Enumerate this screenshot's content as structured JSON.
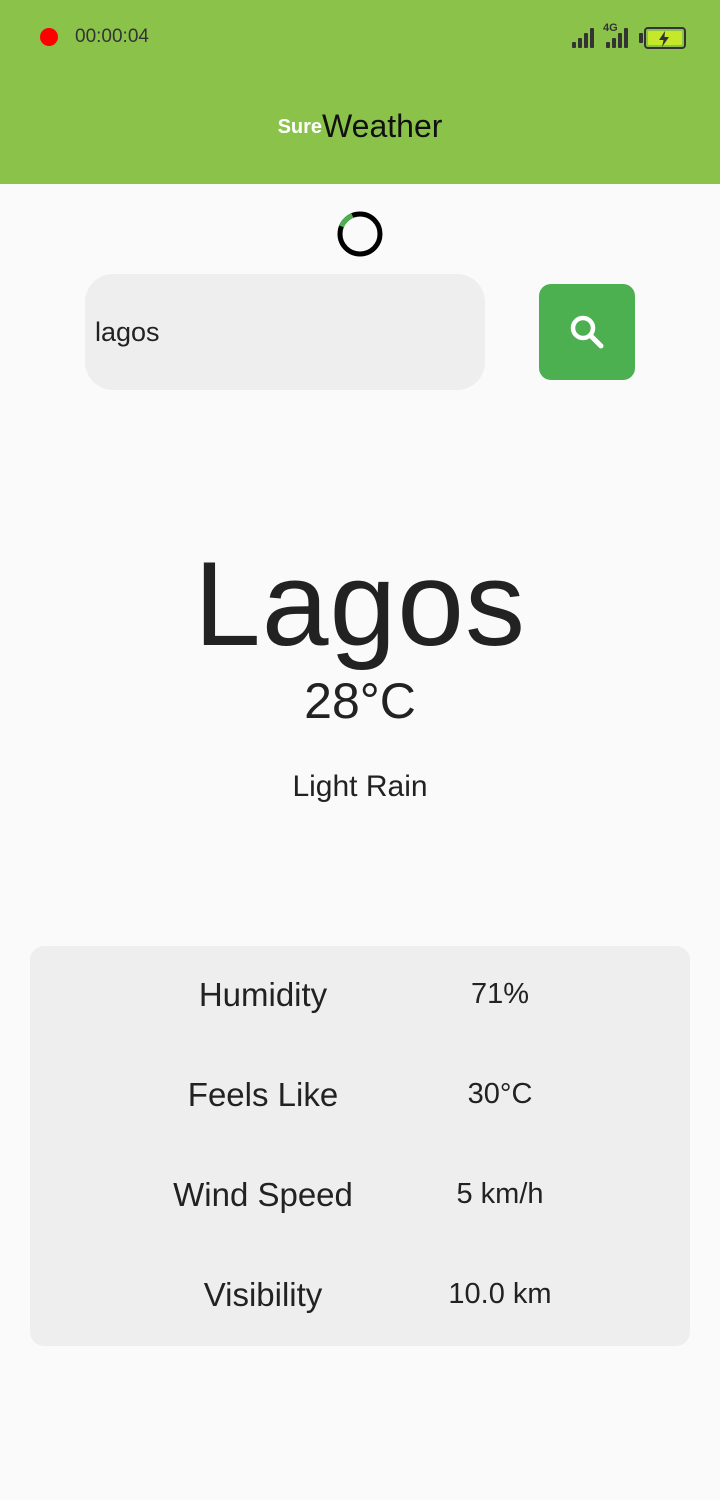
{
  "status_bar": {
    "record_time": "00:00:04",
    "network_label": "4G"
  },
  "app_bar": {
    "title_prefix": "Sure",
    "title_main": "Weather",
    "color": "#8bc34a"
  },
  "search": {
    "value": "lagos",
    "button_icon": "search-icon",
    "button_color": "#4caf50"
  },
  "weather": {
    "city": "Lagos",
    "temperature": "28°C",
    "description": "Light Rain"
  },
  "details": [
    {
      "label": "Humidity",
      "value": "71%"
    },
    {
      "label": "Feels Like",
      "value": "30°C"
    },
    {
      "label": "Wind Speed",
      "value": "5 km/h"
    },
    {
      "label": "Visibility",
      "value": "10.0 km"
    }
  ]
}
